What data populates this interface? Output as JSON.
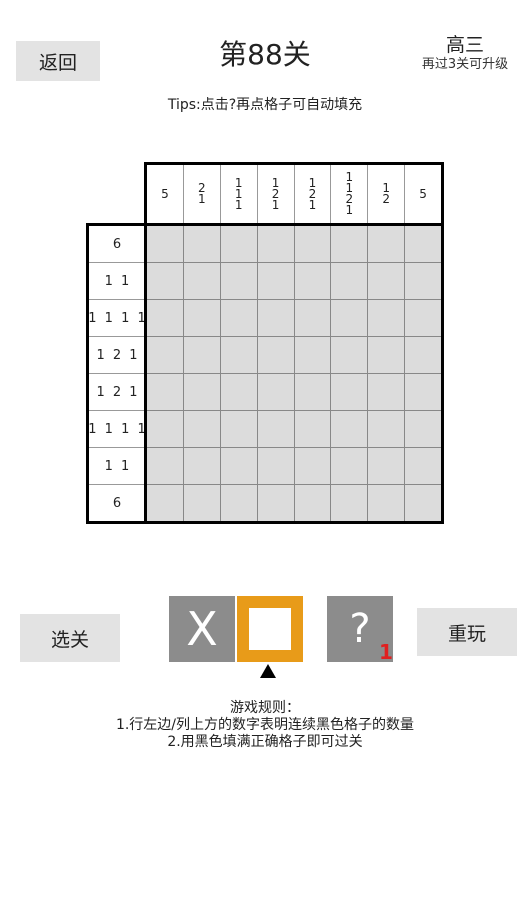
{
  "header": {
    "back_label": "返回",
    "level_title": "第88关",
    "grade": "高三",
    "upgrade_note": "再过3关可升级"
  },
  "tips": "Tips:点击?再点格子可自动填充",
  "puzzle": {
    "column_clues": [
      [
        "5"
      ],
      [
        "2",
        "1"
      ],
      [
        "1",
        "1",
        "1"
      ],
      [
        "1",
        "2",
        "1"
      ],
      [
        "1",
        "2",
        "1"
      ],
      [
        "1",
        "1",
        "2",
        "1"
      ],
      [
        "1",
        "2"
      ],
      [
        "5"
      ]
    ],
    "row_clues": [
      "6",
      "1 1",
      "1 1 1 1",
      "1 2 1",
      "1 2 1",
      "1 1 1 1",
      "1 1",
      "6"
    ],
    "rows": 8,
    "cols": 8
  },
  "controls": {
    "select_label": "选关",
    "cross_tool": "X",
    "fill_tool_icon": "filled-square-icon",
    "hint_tool": "?",
    "hint_count": "1",
    "replay_label": "重玩",
    "selected_tool": "fill"
  },
  "rules": {
    "title": "游戏规则：",
    "line1": "1.行左边/列上方的数字表明连续黑色格子的数量",
    "line2": "2.用黑色填满正确格子即可过关"
  }
}
